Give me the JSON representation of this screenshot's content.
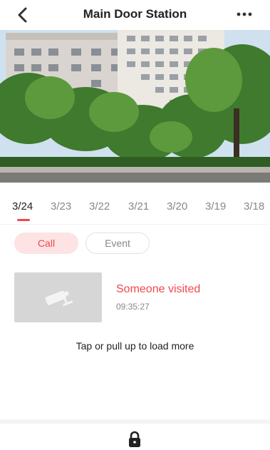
{
  "header": {
    "title": "Main Door Station",
    "back_icon": "chevron-left-icon",
    "more_icon": "more-dots-icon"
  },
  "camera": {
    "content": "live-view"
  },
  "dates": {
    "items": [
      "3/24",
      "3/23",
      "3/22",
      "3/21",
      "3/20",
      "3/19",
      "3/18"
    ],
    "selected_index": 0
  },
  "tabs": {
    "call": "Call",
    "event": "Event",
    "selected": "Call"
  },
  "records": [
    {
      "title": "Someone visited",
      "time": "09:35:27",
      "thumb_icon": "camera-icon"
    }
  ],
  "load_more": "Tap or pull up to load more",
  "bottom": {
    "unlock_icon": "lock-icon"
  },
  "colors": {
    "accent": "#f0484c",
    "accent_light": "#fde3e3",
    "muted": "#888888"
  }
}
